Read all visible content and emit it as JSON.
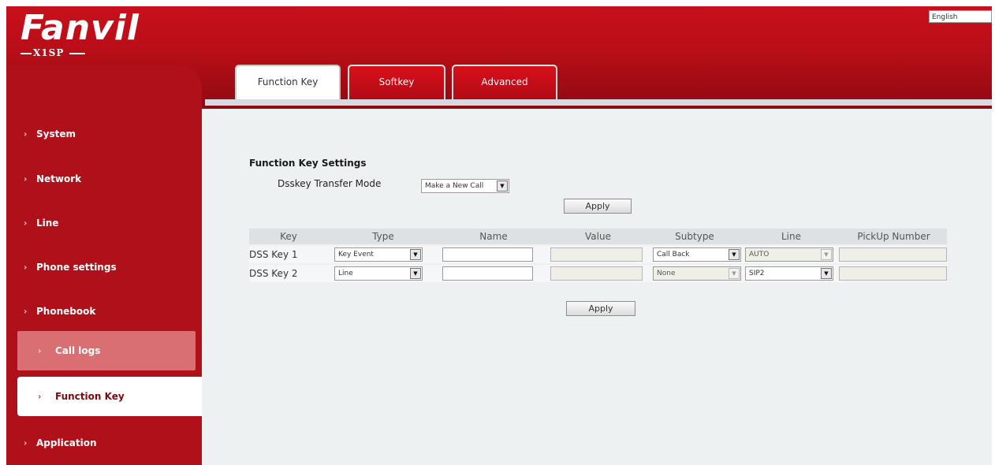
{
  "brand": {
    "logo_text": "Fanvil",
    "model": "X1SP"
  },
  "language": {
    "selected": "English"
  },
  "tabs": [
    {
      "label": "Function Key",
      "active": true
    },
    {
      "label": "Softkey",
      "active": false
    },
    {
      "label": "Advanced",
      "active": false
    }
  ],
  "sidebar": {
    "chevron": "›",
    "items": [
      {
        "label": "System",
        "state": "normal"
      },
      {
        "label": "Network",
        "state": "normal"
      },
      {
        "label": "Line",
        "state": "normal"
      },
      {
        "label": "Phone settings",
        "state": "normal"
      },
      {
        "label": "Phonebook",
        "state": "normal"
      },
      {
        "label": "Call logs",
        "state": "hover"
      },
      {
        "label": "Function Key",
        "state": "selected"
      },
      {
        "label": "Application",
        "state": "normal"
      }
    ]
  },
  "settings": {
    "title": "Function Key Settings",
    "transfer_mode_label": "Dsskey Transfer Mode",
    "transfer_mode_value": "Make a New Call",
    "apply_label": "Apply"
  },
  "table": {
    "headers": [
      "Key",
      "Type",
      "Name",
      "Value",
      "Subtype",
      "Line",
      "PickUp Number"
    ],
    "rows": [
      {
        "key": "DSS Key 1",
        "type": "Key Event",
        "name": "",
        "value": "",
        "subtype": "Call Back",
        "line": "AUTO",
        "pickup": ""
      },
      {
        "key": "DSS Key 2",
        "type": "Line",
        "name": "",
        "value": "",
        "subtype": "None",
        "line": "SIP2",
        "pickup": ""
      }
    ],
    "apply_label": "Apply"
  },
  "icons": {
    "dropdown": "▼"
  },
  "colors": {
    "brand_red": "#b80e18",
    "content_bg": "#eef1f2",
    "header_row": "#dde1e4",
    "highlight": "#d96f72"
  }
}
